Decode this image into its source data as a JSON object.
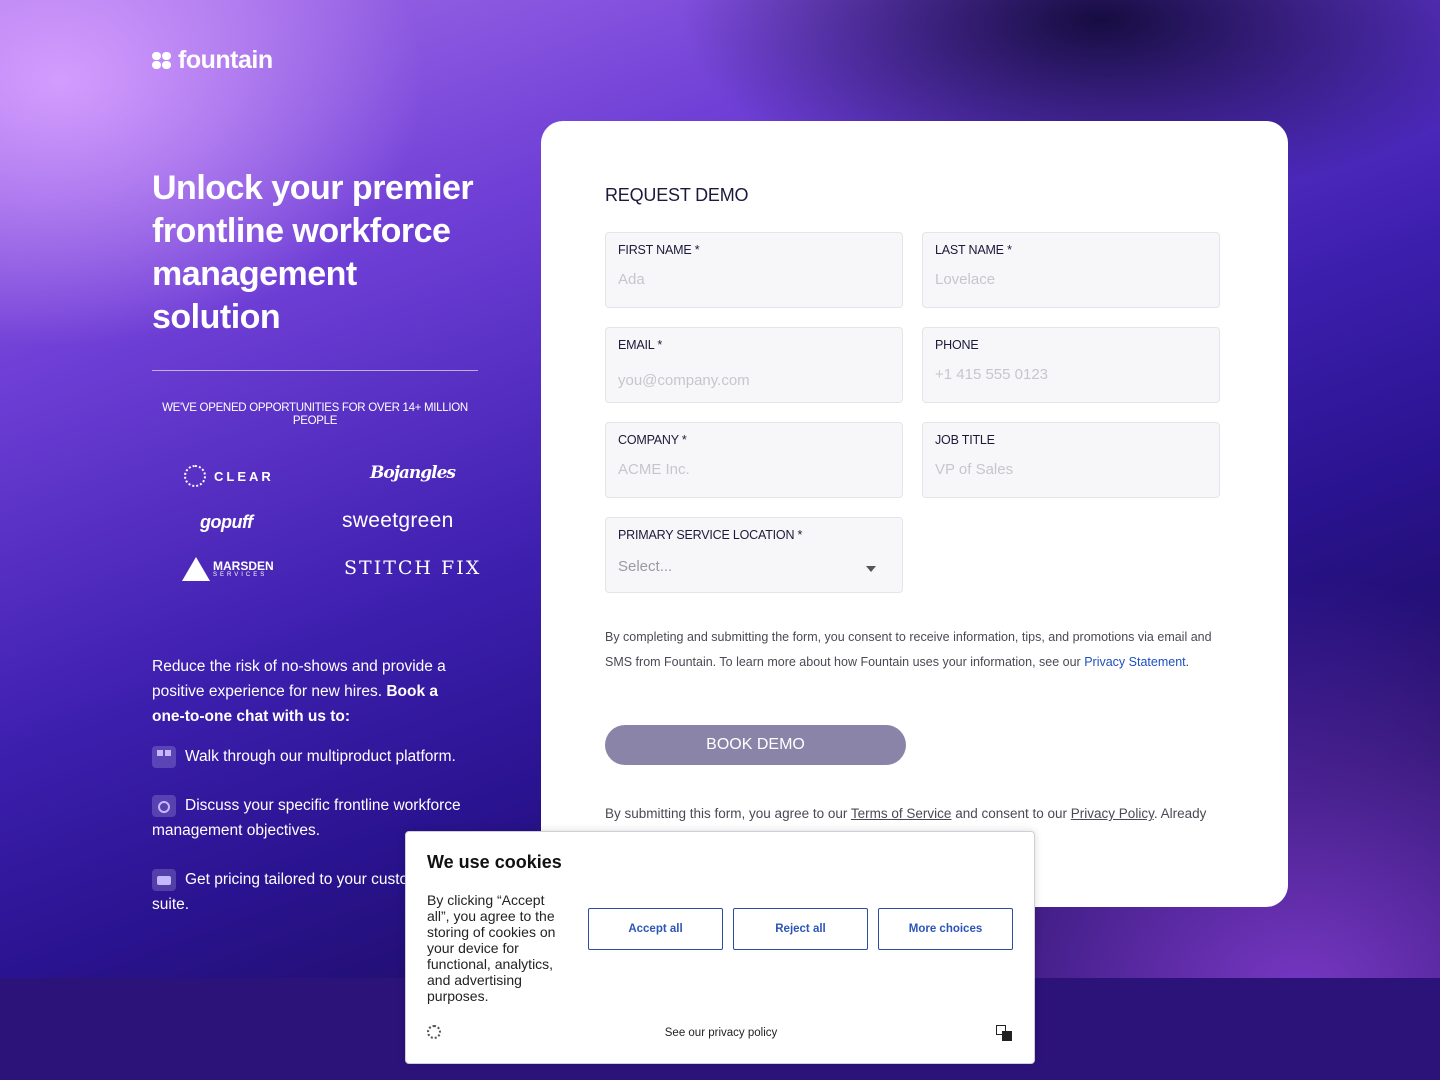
{
  "brand": {
    "name": "fountain"
  },
  "hero": {
    "title": "Unlock your premier frontline workforce management solution",
    "opportunities": "WE'VE OPENED OPPORTUNITIES FOR OVER 14+ MILLION PEOPLE",
    "logos": {
      "clear": "CLEAR",
      "bojangles": "Bojangles",
      "gopuff": "gopuff",
      "sweetgreen": "sweetgreen",
      "marsden": "MARSDEN",
      "marsden_sub": "SERVICES",
      "stitchfix": "STITCH FIX"
    },
    "reduce_text": "Reduce the risk of no-shows and provide a positive experience for new hires.",
    "reduce_bold": "Book a one-to-one chat with us to:",
    "bullets": [
      "Walk through our multiproduct platform.",
      "Discuss your specific frontline workforce management objectives.",
      "Get pricing tailored to your custom product suite."
    ]
  },
  "form": {
    "title": "REQUEST DEMO",
    "fields": {
      "first_name": {
        "label": "FIRST NAME *",
        "placeholder": "Ada"
      },
      "last_name": {
        "label": "LAST NAME *",
        "placeholder": "Lovelace"
      },
      "email": {
        "label": "EMAIL *",
        "placeholder": "you@company.com"
      },
      "phone": {
        "label": "PHONE",
        "placeholder": "+1 415 555 0123"
      },
      "company": {
        "label": "COMPANY *",
        "placeholder": "ACME Inc."
      },
      "job_title": {
        "label": "JOB TITLE",
        "placeholder": "VP of Sales"
      },
      "location": {
        "label": "PRIMARY SERVICE LOCATION *",
        "value": "Select..."
      }
    },
    "consent_text": "By completing and submitting the form, you consent to receive information, tips, and promotions via email and SMS from Fountain. To learn more about how Fountain uses your information, see our",
    "consent_link": "Privacy Statement",
    "consent_end": ".",
    "submit_label": "BOOK DEMO",
    "agree_prefix": "By submitting this form, you agree to our",
    "terms_link": "Terms of Service",
    "agree_middle": "and consent to our",
    "privacy_link": "Privacy Policy",
    "agree_suffix": ". Already"
  },
  "cookie": {
    "title": "We use cookies",
    "text": "By clicking “Accept all”, you agree to the storing of cookies on your device for functional, analytics, and advertising purposes.",
    "accept": "Accept all",
    "reject": "Reject all",
    "more": "More choices",
    "privacy": "See our privacy policy"
  },
  "colors": {
    "card_bg": "#ffffff",
    "button_bg": "#8a84a8",
    "link": "#1f4fbf",
    "cookie_button_border": "#2d4c9e"
  }
}
